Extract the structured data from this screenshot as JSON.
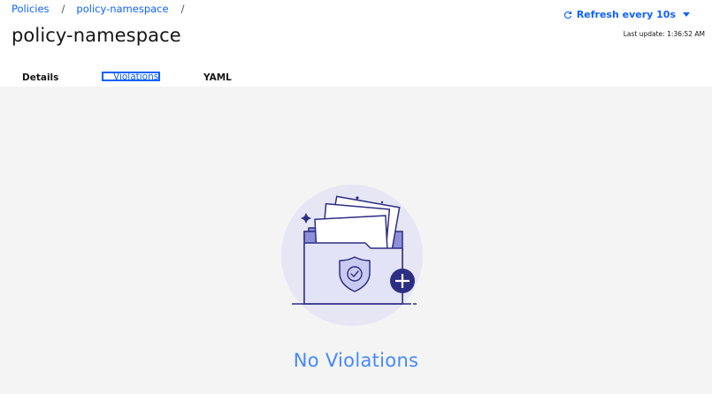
{
  "breadcrumb": {
    "items": [
      {
        "label": "Policies"
      },
      {
        "label": "policy-namespace"
      }
    ],
    "separator": "/"
  },
  "page": {
    "title": "policy-namespace"
  },
  "refresh": {
    "label": "Refresh every 10s",
    "last_update_label": "Last update:",
    "last_update_time": "1:36:52 AM"
  },
  "tabs": [
    {
      "label": "Details",
      "selected": false
    },
    {
      "label": "Violations",
      "selected": true
    },
    {
      "label": "YAML",
      "selected": false
    }
  ],
  "empty_state": {
    "icon": "folder-shield-icon",
    "message": "No Violations"
  },
  "colors": {
    "accent": "#0f62fe",
    "empty_text": "#4589ff",
    "content_bg": "#f4f4f4",
    "illustration_bg": "#e8e8f8",
    "illustration_stroke": "#2d2e83",
    "illustration_fill": "#c9caf0"
  }
}
